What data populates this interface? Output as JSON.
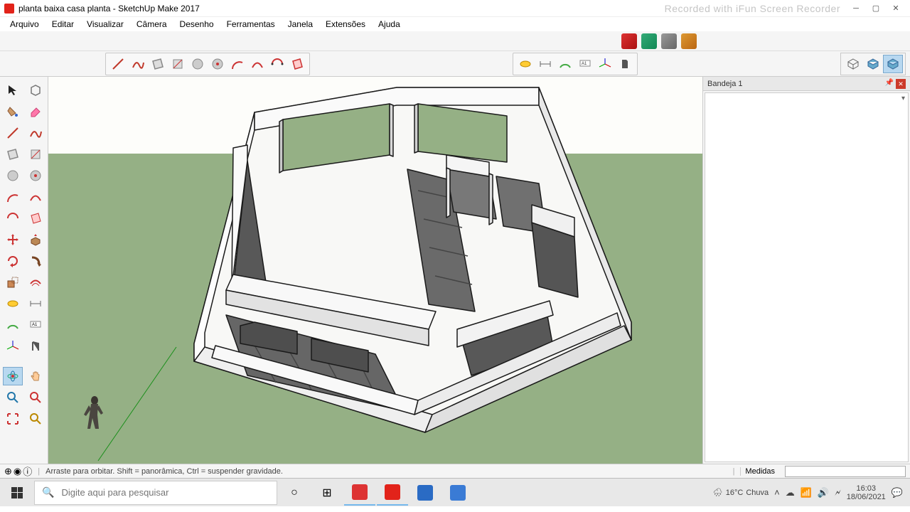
{
  "titlebar": {
    "document": "planta baixa casa planta",
    "app": "SketchUp Make 2017",
    "full": "planta baixa casa planta - SketchUp Make 2017",
    "watermark": "Recorded with iFun Screen Recorder"
  },
  "menubar": [
    "Arquivo",
    "Editar",
    "Visualizar",
    "Câmera",
    "Desenho",
    "Ferramentas",
    "Janela",
    "Extensões",
    "Ajuda"
  ],
  "tray": {
    "title": "Bandeja 1"
  },
  "statusbar": {
    "hint": "Arraste para orbitar. Shift = panorâmica, Ctrl = suspender gravidade.",
    "measure_label": "Medidas"
  },
  "taskbar": {
    "search_placeholder": "Digite aqui para pesquisar",
    "weather_temp": "16°C",
    "weather_cond": "Chuva",
    "time": "16:03",
    "date": "18/06/2021"
  }
}
